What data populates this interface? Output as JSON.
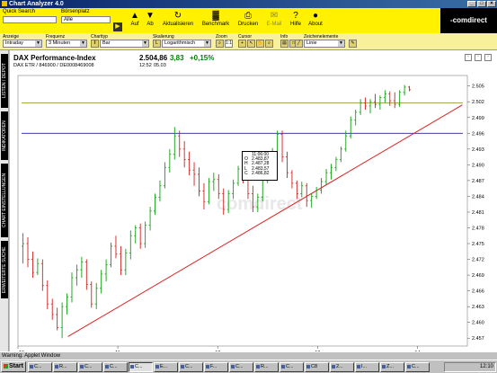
{
  "window": {
    "title": "Chart Analyzer 4.0"
  },
  "toolbar": {
    "quick_search_label": "Quick Search",
    "boersenplatz_label": "Börsenplatz",
    "boersenplatz_value": "Alle",
    "go_label": "▶",
    "buttons": [
      {
        "label": "Auf",
        "icon": "▲"
      },
      {
        "label": "Ab",
        "icon": "▼"
      },
      {
        "label": "Aktualisieren",
        "icon": "↻"
      },
      {
        "label": "Benchmark",
        "icon": "▓"
      },
      {
        "label": "Drucken",
        "icon": "⎙"
      },
      {
        "label": "E-Mail",
        "icon": "✉"
      },
      {
        "label": "Hilfe",
        "icon": "?"
      },
      {
        "label": "About",
        "icon": "●"
      }
    ],
    "logo": "-comdirect"
  },
  "options": {
    "anzeige": {
      "label": "Anzeige",
      "value": "Intraday"
    },
    "frequenz": {
      "label": "Frequenz",
      "value": "3 Minuten"
    },
    "charttyp": {
      "label": "Charttyp",
      "value": "Bar"
    },
    "skalierung": {
      "label": "Skalierung",
      "value": "Logarithmisch"
    },
    "zoom": {
      "label": "Zoom",
      "value": "1:1"
    },
    "cursor": {
      "label": "Cursor"
    },
    "info": {
      "label": "Info"
    },
    "zeichenelemente": {
      "label": "Zeichenelemente",
      "value": "Linie"
    }
  },
  "sidebar": {
    "tabs": [
      "LISTEN / DEPOT",
      "INDIKATOREN",
      "CHART EINSTELLUNGEN",
      "ERWEITERTE SUCHE"
    ]
  },
  "chart_header": {
    "title": "DAX Performance-Index",
    "subtitle": "DAX ETR / 846900 / DE0008469008",
    "price": "2.504,86",
    "change": "3,83",
    "change_pct": "+0,15%",
    "time": "12:52",
    "date": "05.03"
  },
  "tooltip": {
    "time": "11:06:00",
    "rows": [
      {
        "k": "O",
        "v": "2.483,87"
      },
      {
        "k": "H",
        "v": "2.487,28"
      },
      {
        "k": "L",
        "v": "2.483,57"
      },
      {
        "k": "C",
        "v": "2.486,82"
      }
    ]
  },
  "watermark": "comdirect",
  "status": {
    "text": "Warning: Applet Window"
  },
  "taskbar": {
    "start": "Start",
    "tasks": [
      "C...",
      "R...",
      "C...",
      "C...",
      "C...",
      "E...",
      "C...",
      "F...",
      "C...",
      "R...",
      "C...",
      "C8",
      "2...",
      "I...",
      "Z...",
      "C..."
    ],
    "clock": "12:10"
  },
  "chart_data": {
    "type": "ohlc",
    "title": "DAX Performance-Index",
    "x_ticks": [
      "10",
      "11",
      "12",
      "13",
      "14"
    ],
    "x_subtick": "05.03",
    "y_ticks": [
      2457,
      2460,
      2463,
      2466,
      2469,
      2472,
      2475,
      2478,
      2481,
      2484,
      2487,
      2490,
      2493,
      2496,
      2499,
      2502,
      2505
    ],
    "ylim": [
      2455.5,
      2507
    ],
    "xlim": [
      10.0,
      14.5
    ],
    "horizontal_lines": [
      {
        "y": 2501.8,
        "color": "#9a9a30"
      },
      {
        "y": 2496.0,
        "color": "#2020a0"
      }
    ],
    "trend_line": {
      "x": [
        10.5,
        14.45
      ],
      "y": [
        2457.3,
        2501.4
      ],
      "color": "#e02020"
    },
    "series": [
      {
        "values": [
          [
            2474.5,
            2477.0,
            2471.2,
            2475.0
          ],
          [
            2475.0,
            2476.2,
            2470.5,
            2472.0
          ],
          [
            2472.0,
            2473.5,
            2468.5,
            2469.5
          ],
          [
            2469.5,
            2472.2,
            2469.0,
            2471.2
          ],
          [
            2471.2,
            2472.0,
            2466.0,
            2467.0
          ],
          [
            2467.0,
            2468.0,
            2462.5,
            2463.5
          ],
          [
            2463.5,
            2464.5,
            2460.5,
            2461.5
          ],
          [
            2461.5,
            2462.8,
            2458.5,
            2459.0
          ],
          [
            2459.0,
            2463.8,
            2457.0,
            2463.0
          ],
          [
            2463.0,
            2465.5,
            2461.5,
            2464.8
          ],
          [
            2464.8,
            2469.5,
            2463.8,
            2468.5
          ],
          [
            2468.5,
            2471.0,
            2467.0,
            2470.0
          ],
          [
            2470.0,
            2472.5,
            2468.5,
            2471.5
          ],
          [
            2471.5,
            2472.0,
            2466.2,
            2467.2
          ],
          [
            2467.2,
            2467.8,
            2462.8,
            2463.5
          ],
          [
            2463.5,
            2467.5,
            2462.5,
            2466.5
          ],
          [
            2466.5,
            2470.0,
            2465.5,
            2469.2
          ],
          [
            2469.2,
            2472.0,
            2467.8,
            2471.0
          ],
          [
            2471.0,
            2475.2,
            2470.5,
            2474.5
          ],
          [
            2474.5,
            2476.5,
            2472.2,
            2473.0
          ],
          [
            2473.0,
            2474.5,
            2469.0,
            2470.0
          ],
          [
            2470.0,
            2474.0,
            2469.0,
            2473.2
          ],
          [
            2473.2,
            2477.5,
            2472.0,
            2476.5
          ],
          [
            2476.5,
            2478.5,
            2475.0,
            2478.0
          ],
          [
            2478.0,
            2478.8,
            2474.0,
            2475.0
          ],
          [
            2475.0,
            2479.2,
            2474.2,
            2478.5
          ],
          [
            2478.5,
            2482.0,
            2477.5,
            2481.2
          ],
          [
            2481.2,
            2484.5,
            2480.5,
            2483.8
          ],
          [
            2483.8,
            2487.0,
            2483.0,
            2486.0
          ],
          [
            2486.0,
            2490.5,
            2485.5,
            2489.5
          ],
          [
            2489.5,
            2493.0,
            2488.5,
            2492.0
          ],
          [
            2492.0,
            2497.2,
            2491.0,
            2495.5
          ],
          [
            2495.5,
            2496.5,
            2491.5,
            2493.0
          ],
          [
            2493.0,
            2494.5,
            2489.5,
            2491.0
          ],
          [
            2491.0,
            2492.5,
            2488.0,
            2489.0
          ],
          [
            2489.0,
            2490.5,
            2486.0,
            2488.2
          ],
          [
            2488.2,
            2489.5,
            2484.0,
            2485.0
          ],
          [
            2485.0,
            2486.5,
            2481.5,
            2483.0
          ],
          [
            2483.0,
            2487.5,
            2482.5,
            2486.8
          ],
          [
            2486.8,
            2488.5,
            2485.0,
            2487.2
          ],
          [
            2487.2,
            2488.2,
            2483.5,
            2484.5
          ],
          [
            2484.5,
            2485.5,
            2480.5,
            2481.5
          ],
          [
            2481.5,
            2485.2,
            2480.8,
            2484.5
          ],
          [
            2484.5,
            2487.2,
            2483.5,
            2486.5
          ],
          [
            2486.5,
            2489.8,
            2486.0,
            2489.2
          ],
          [
            2489.2,
            2490.2,
            2486.5,
            2487.5
          ],
          [
            2487.5,
            2488.5,
            2483.5,
            2484.5
          ],
          [
            2484.5,
            2486.0,
            2481.0,
            2482.0
          ],
          [
            2482.0,
            2484.5,
            2481.0,
            2483.8
          ],
          [
            2483.8,
            2487.8,
            2483.0,
            2487.0
          ],
          [
            2487.0,
            2490.0,
            2486.5,
            2489.5
          ],
          [
            2489.5,
            2493.2,
            2488.8,
            2492.5
          ],
          [
            2492.5,
            2496.5,
            2491.8,
            2495.8
          ],
          [
            2495.8,
            2496.5,
            2490.5,
            2491.5
          ],
          [
            2491.5,
            2492.5,
            2487.5,
            2488.5
          ],
          [
            2488.5,
            2489.0,
            2485.5,
            2486.5
          ],
          [
            2486.5,
            2487.0,
            2483.5,
            2484.5
          ],
          [
            2484.5,
            2486.8,
            2483.8,
            2486.0
          ],
          [
            2486.0,
            2486.5,
            2482.0,
            2483.2
          ],
          [
            2483.2,
            2484.5,
            2481.8,
            2484.0
          ],
          [
            2484.0,
            2485.8,
            2483.5,
            2485.2
          ],
          [
            2485.2,
            2487.5,
            2484.5,
            2486.8
          ],
          [
            2486.8,
            2489.2,
            2486.2,
            2488.5
          ],
          [
            2488.5,
            2490.2,
            2487.2,
            2489.5
          ],
          [
            2489.5,
            2491.5,
            2488.8,
            2491.0
          ],
          [
            2491.0,
            2493.5,
            2490.5,
            2493.0
          ],
          [
            2493.0,
            2496.5,
            2492.5,
            2495.5
          ],
          [
            2495.5,
            2499.2,
            2495.0,
            2498.5
          ],
          [
            2498.5,
            2500.5,
            2497.5,
            2500.0
          ],
          [
            2500.0,
            2502.5,
            2499.5,
            2501.8
          ],
          [
            2501.8,
            2502.8,
            2500.5,
            2501.2
          ],
          [
            2501.2,
            2502.5,
            2499.8,
            2502.0
          ],
          [
            2502.0,
            2503.5,
            2500.8,
            2501.5
          ],
          [
            2501.5,
            2503.2,
            2500.5,
            2502.8
          ],
          [
            2502.8,
            2504.2,
            2501.8,
            2503.5
          ],
          [
            2503.5,
            2504.0,
            2501.2,
            2502.2
          ],
          [
            2502.2,
            2503.8,
            2500.8,
            2501.5
          ],
          [
            2501.5,
            2504.2,
            2501.0,
            2503.8
          ],
          [
            2503.8,
            2505.2,
            2503.2,
            2504.8
          ],
          [
            2504.8,
            2505.0,
            2504.0,
            2504.3
          ]
        ]
      }
    ]
  }
}
